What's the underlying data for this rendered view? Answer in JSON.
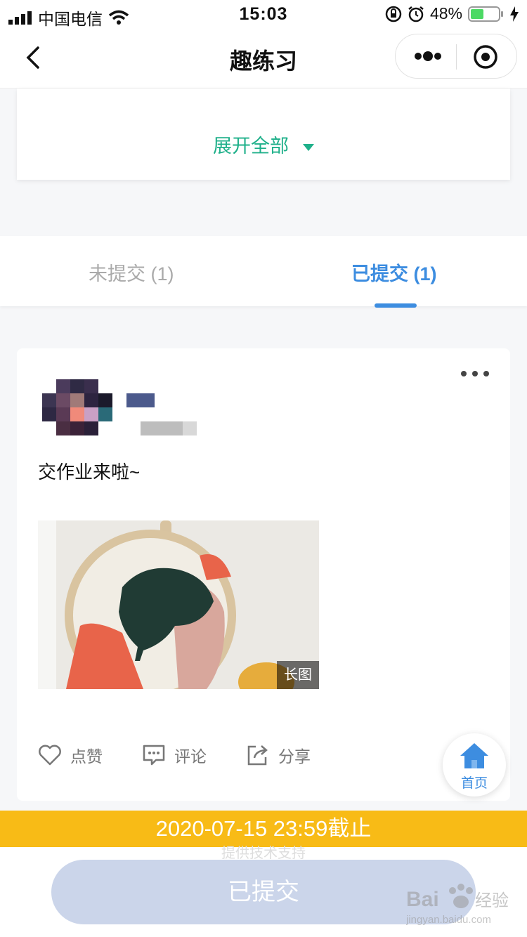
{
  "status_bar": {
    "carrier": "中国电信",
    "time": "15:03",
    "battery": "48%",
    "battery_level": 0.48
  },
  "nav": {
    "title": "趣练习"
  },
  "expand": {
    "label": "展开全部"
  },
  "tabs": [
    {
      "label": "未提交 (1)",
      "active": false
    },
    {
      "label": "已提交 (1)",
      "active": true
    }
  ],
  "post": {
    "text": "交作业来啦~",
    "image_tag": "长图",
    "actions": {
      "like": "点赞",
      "comment": "评论",
      "share": "分享"
    }
  },
  "home": {
    "label": "首页"
  },
  "deadline": "2020-07-15 23:59截止",
  "ghost_text": "提供技术支持",
  "submit_button": "已提交",
  "watermark": {
    "brand": "Bai 经验",
    "url": "jingyan.baidu.com"
  },
  "colors": {
    "accent_green": "#1fb08a",
    "accent_blue": "#3d8de0",
    "deadline_bg": "#f8bb16",
    "submit_bg": "#cbd5ea"
  }
}
